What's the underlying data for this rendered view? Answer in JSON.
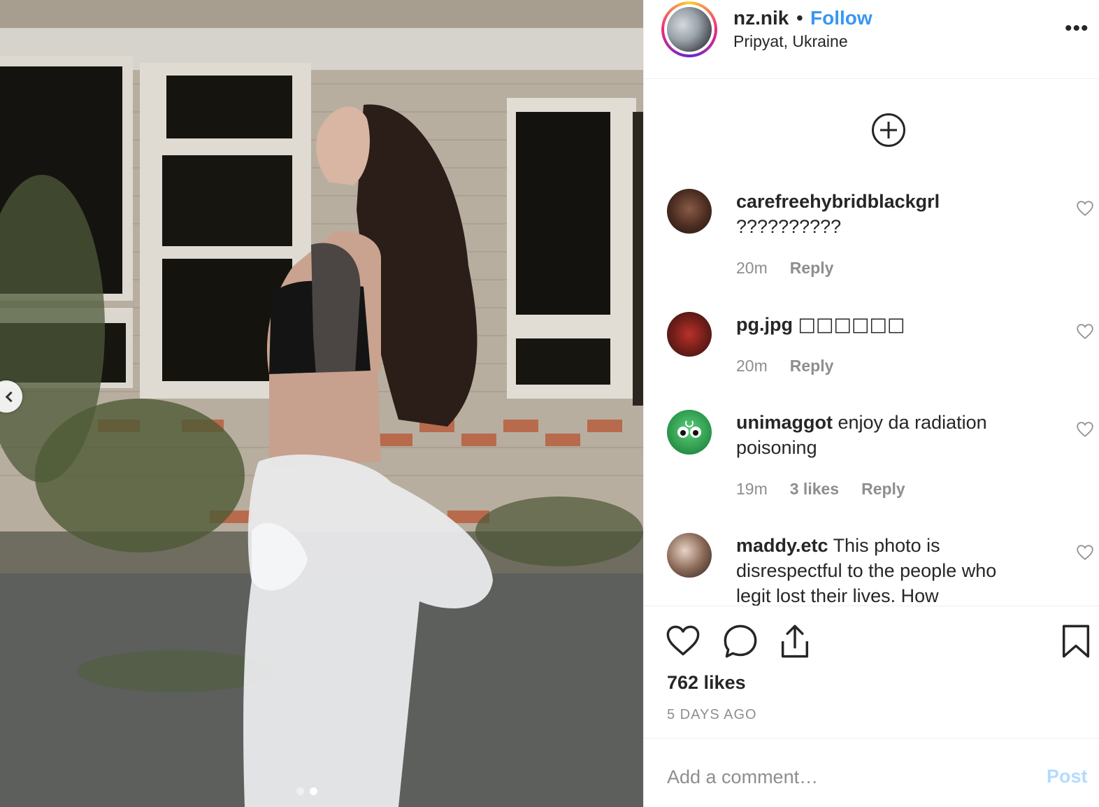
{
  "post": {
    "username": "nz.nik",
    "separator": "•",
    "follow_label": "Follow",
    "location": "Pripyat, Ukraine",
    "more_label": "•••"
  },
  "carousel": {
    "image_count": 2,
    "active_index": 1
  },
  "comments": [
    {
      "username": "carefreehybridblackgrl",
      "text": "??????????",
      "time": "20m",
      "likes": "",
      "reply": "Reply"
    },
    {
      "username": "pg.jpg",
      "text": "□□□□□□",
      "time": "20m",
      "likes": "",
      "reply": "Reply"
    },
    {
      "username": "unimaggot",
      "text": "enjoy da radiation poisoning",
      "time": "19m",
      "likes": "3 likes",
      "reply": "Reply"
    },
    {
      "username": "maddy.etc",
      "text": "This photo is disrespectful to the people who legit lost their lives. How",
      "time": "",
      "likes": "",
      "reply": ""
    }
  ],
  "footer": {
    "likes": "762 likes",
    "timestamp": "5 DAYS AGO",
    "comment_placeholder": "Add a comment…",
    "post_label": "Post"
  },
  "colors": {
    "accent": "#3897f0",
    "text": "#262626",
    "muted": "#8e8e8e",
    "post_disabled": "#b3dbff"
  },
  "icons": [
    "plus-circle-icon",
    "heart-icon",
    "comment-icon",
    "share-icon",
    "bookmark-icon",
    "chevron-left-icon",
    "more-icon"
  ]
}
